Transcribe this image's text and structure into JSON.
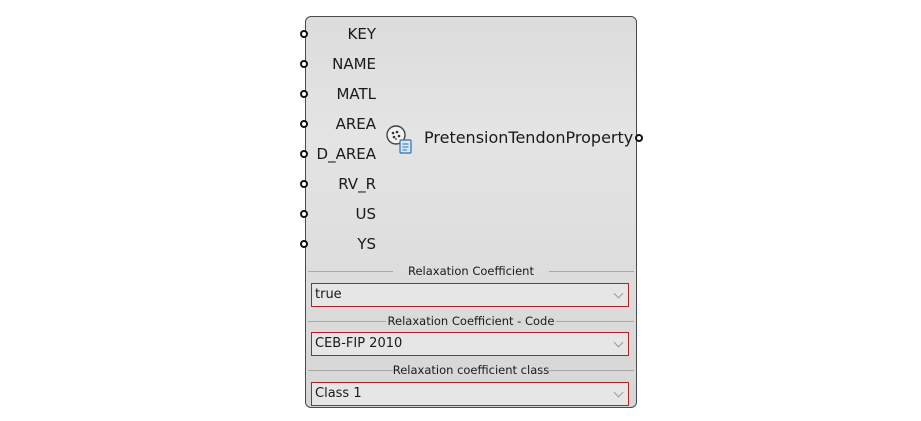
{
  "component": {
    "title": "PretensionTendonProperty",
    "icon": "pretension-tendon-icon",
    "inputs": [
      "KEY",
      "NAME",
      "MATL",
      "AREA",
      "D_AREA",
      "RV_R",
      "US",
      "YS"
    ]
  },
  "settings": [
    {
      "label": "Relaxation Coefficient",
      "value": "true"
    },
    {
      "label": "Relaxation Coefficient - Code",
      "value": "CEB-FIP 2010"
    },
    {
      "label": "Relaxation coefficient class",
      "value": "Class 1"
    }
  ],
  "colors": {
    "dropdown_border": "#b22222",
    "body": "#dedede",
    "outline": "#4a4a4a"
  }
}
